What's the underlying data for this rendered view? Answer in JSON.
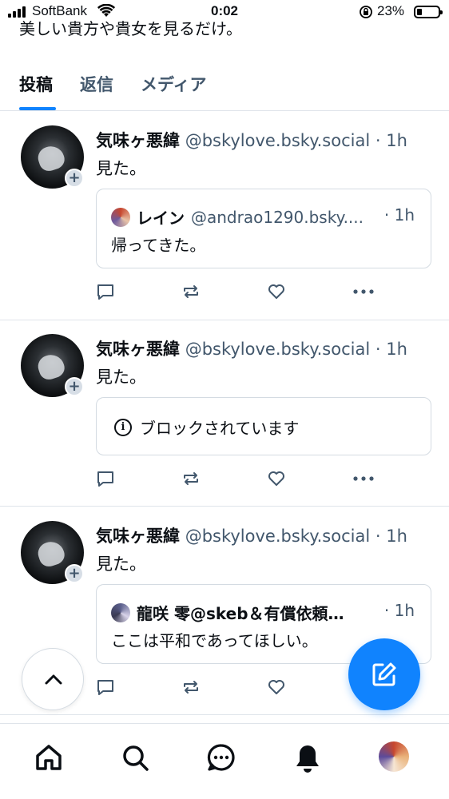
{
  "status_bar": {
    "carrier": "SoftBank",
    "time": "0:02",
    "battery_pct": "23%"
  },
  "profile": {
    "bio_fragment": "美しい貴方や貴女を見るだけ。"
  },
  "tabs": [
    {
      "label": "投稿",
      "active": true
    },
    {
      "label": "返信",
      "active": false
    },
    {
      "label": "メディア",
      "active": false
    }
  ],
  "posts": [
    {
      "author_name": "気味ヶ悪緯",
      "handle": "@bskylove.bsky.social",
      "dot": "·",
      "time": "1h",
      "text": "見た。",
      "quote": {
        "author_name": "レイン",
        "handle": "@andrao1290.bsky....",
        "dot": "·",
        "time": "1h",
        "text": "帰ってきた。"
      }
    },
    {
      "author_name": "気味ヶ悪緯",
      "handle": "@bskylove.bsky.social",
      "dot": "·",
      "time": "1h",
      "text": "見た。",
      "blocked_notice": "ブロックされています"
    },
    {
      "author_name": "気味ヶ悪緯",
      "handle": "@bskylove.bsky.social",
      "dot": "·",
      "time": "1h",
      "text": "見た。",
      "quote": {
        "author_name": "龍咲 零@skeb＆有償依頼…",
        "handle": "",
        "dot": "·",
        "time": "1h",
        "text": "ここは平和であってほしい。"
      }
    }
  ],
  "icons": {
    "reply": "speech-bubble-icon",
    "repost": "repost-icon",
    "like": "heart-icon",
    "more": "ellipsis-icon",
    "scroll_top": "chevron-up-icon",
    "compose": "compose-icon",
    "nav": [
      "home-icon",
      "search-icon",
      "chat-icon",
      "bell-icon",
      "avatar"
    ]
  },
  "colors": {
    "accent": "#1083fe",
    "muted": "#42576c",
    "border": "#dfe4ea"
  }
}
